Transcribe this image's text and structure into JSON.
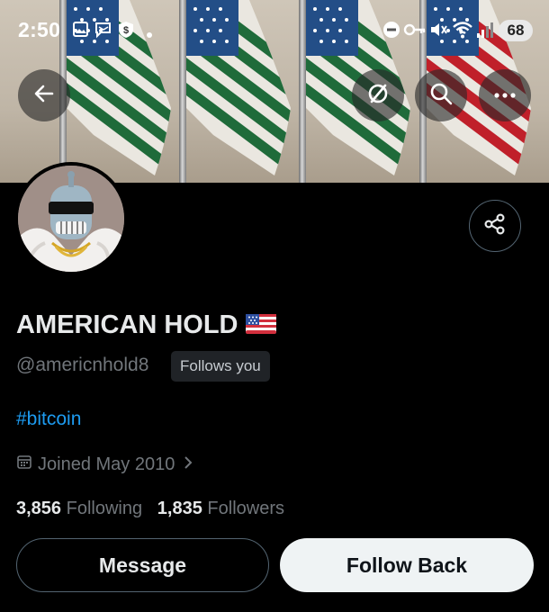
{
  "status_bar": {
    "time": "2:50",
    "battery": "68",
    "icons": [
      "gallery-icon",
      "message-icon",
      "shield-dollar-icon",
      "dot-icon",
      "dnd-icon",
      "key-icon",
      "mute-icon",
      "wifi-icon",
      "signal-icon"
    ]
  },
  "banner_actions": [
    "back-icon",
    "sync-icon",
    "search-icon",
    "more-icon"
  ],
  "profile": {
    "display_name": "AMERICAN HOLD",
    "handle": "@americnhold8",
    "follows_you": "Follows you",
    "bio": "#bitcoin",
    "joined": "Joined May 2010",
    "following_count": "3,856",
    "following_label": "Following",
    "followers_count": "1,835",
    "followers_label": "Followers"
  },
  "buttons": {
    "message": "Message",
    "follow_back": "Follow Back"
  },
  "colors": {
    "background": "#000000",
    "link": "#1d9bf0",
    "muted": "#71767b",
    "text": "#e7e9ea",
    "follow_bg": "#eff3f4",
    "flag_green": "#1f6b3a",
    "flag_red": "#c0202a"
  }
}
